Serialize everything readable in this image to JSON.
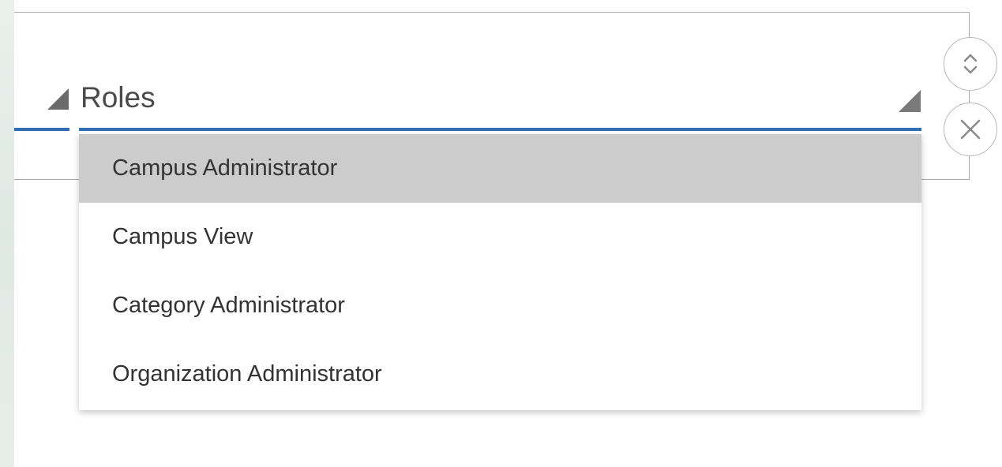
{
  "field": {
    "label": "Roles"
  },
  "dropdown": {
    "options": [
      {
        "label": "Campus Administrator",
        "highlighted": true
      },
      {
        "label": "Campus View",
        "highlighted": false
      },
      {
        "label": "Category Administrator",
        "highlighted": false
      },
      {
        "label": "Organization Administrator",
        "highlighted": false
      }
    ]
  },
  "icons": {
    "left_toggle": "collapse-triangle-icon",
    "field_toggle": "dropdown-triangle-icon",
    "reorder": "up-down-chevron-icon",
    "remove": "close-icon"
  },
  "colors": {
    "accent": "#2f6db5",
    "highlight": "#cccccc",
    "text": "#333333"
  }
}
